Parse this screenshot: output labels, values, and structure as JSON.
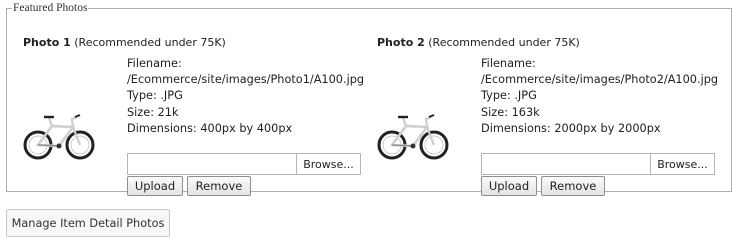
{
  "section": {
    "legend": "Featured Photos"
  },
  "photos": [
    {
      "title": "Photo 1",
      "note": "(Recommended under 75K)",
      "filename_label": "Filename:",
      "filename": "/Ecommerce/site/images/Photo1/A100.jpg",
      "type": "Type: .JPG",
      "size": "Size: 21k",
      "dimensions": "Dimensions: 400px by 400px",
      "file_value": "",
      "browse_label": "Browse...",
      "upload_label": "Upload",
      "remove_label": "Remove"
    },
    {
      "title": "Photo 2",
      "note": "(Recommended under 75K)",
      "filename_label": "Filename:",
      "filename": "/Ecommerce/site/images/Photo2/A100.jpg",
      "type": "Type: .JPG",
      "size": "Size: 163k",
      "dimensions": "Dimensions: 2000px by 2000px",
      "file_value": "",
      "browse_label": "Browse...",
      "upload_label": "Upload",
      "remove_label": "Remove"
    }
  ],
  "manage_button": {
    "label": "Manage Item Detail Photos"
  },
  "icons": {
    "thumbnail": "bicycle-icon"
  }
}
